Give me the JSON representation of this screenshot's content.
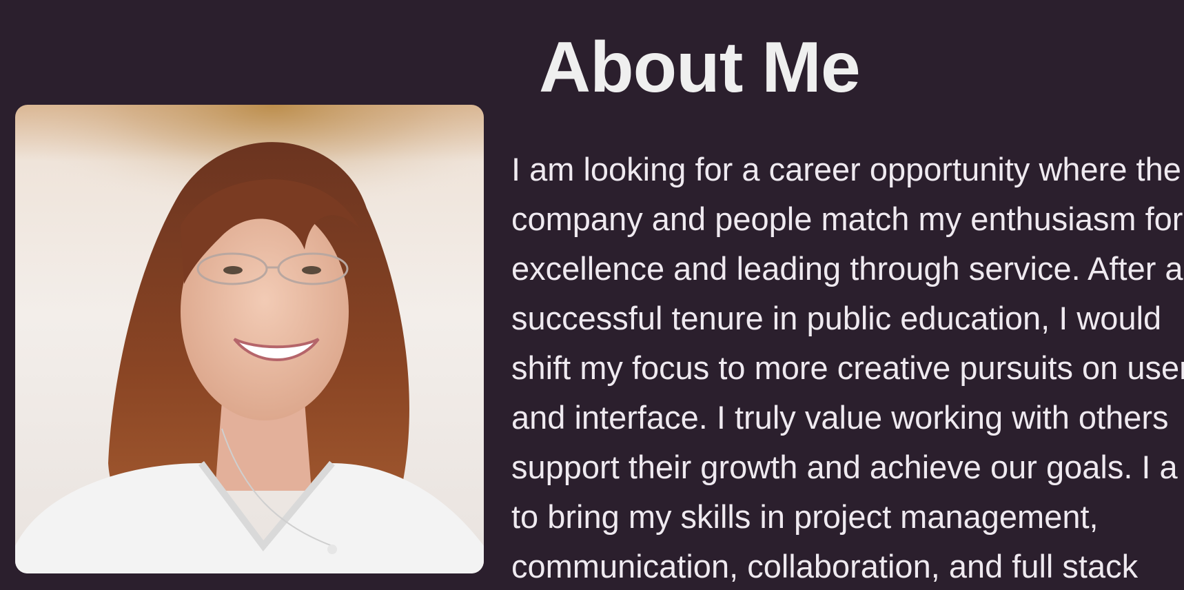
{
  "about": {
    "heading": "About Me",
    "portrait_alt": "Portrait photo",
    "bio_lines": [
      "I am looking for a career opportunity where the",
      "company and people match my enthusiasm for",
      "excellence and leading through service. After a",
      "successful tenure in public education, I would",
      "shift my focus to more creative pursuits on user",
      "and interface. I truly value working with others",
      "support their growth and achieve our goals. I a",
      "to bring my skills in project management,",
      "communication, collaboration, and full stack"
    ]
  }
}
